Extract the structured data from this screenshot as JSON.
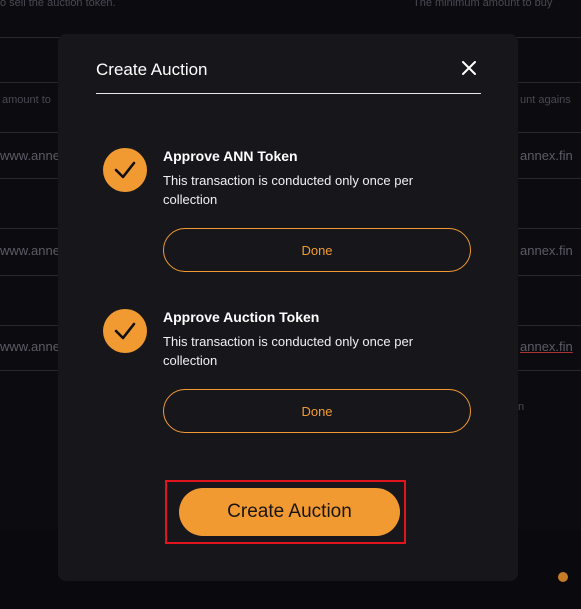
{
  "background": {
    "header_left": "o sell the auction token.",
    "header_right": "The minimum amount to buy",
    "row_left_label": "amount to",
    "row_right_label": "unt agains",
    "rows": [
      {
        "left": "www.anne",
        "right": "annex.fin"
      },
      {
        "left": "www.anne",
        "right": "annex.fin"
      },
      {
        "left": "www.anne",
        "right": "annex.fin"
      }
    ],
    "stray_char": "n"
  },
  "modal": {
    "title": "Create Auction",
    "close_icon": "close-icon",
    "steps": [
      {
        "title": "Approve ANN Token",
        "description": "This transaction is conducted only once per collection",
        "button_label": "Done",
        "status_icon": "check-icon"
      },
      {
        "title": "Approve Auction Token",
        "description": "This transaction is conducted only once per collection",
        "button_label": "Done",
        "status_icon": "check-icon"
      }
    ],
    "create_button_label": "Create Auction"
  },
  "colors": {
    "accent": "#f19a32",
    "modal_bg": "#17171b",
    "highlight_border": "#e0151e"
  }
}
